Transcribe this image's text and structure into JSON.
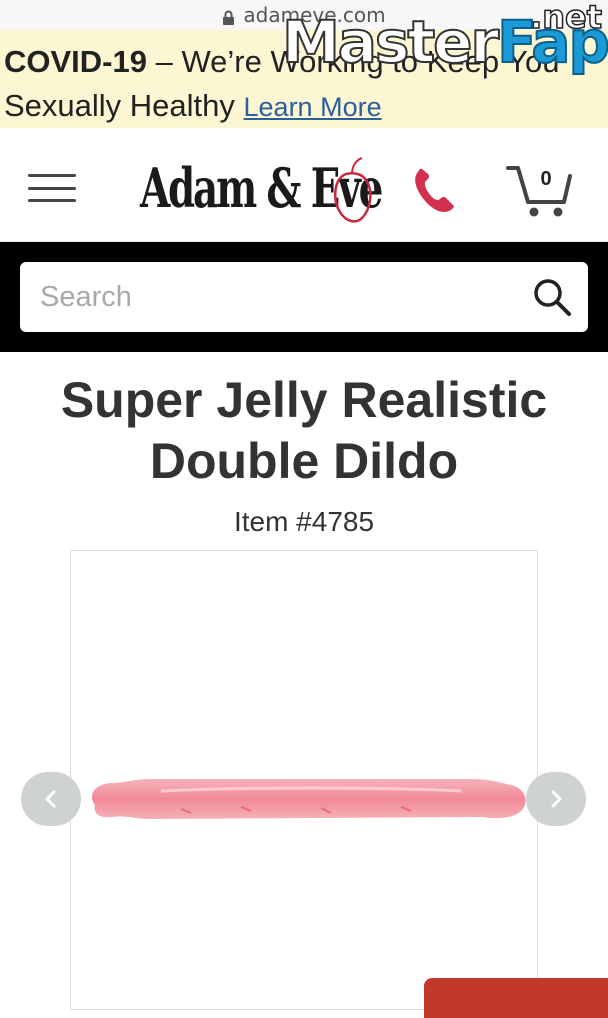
{
  "browser": {
    "url": "adameve.com"
  },
  "watermark": {
    "tld": ".net",
    "name_part1": "Master",
    "name_part2": "Fap"
  },
  "banner": {
    "bold": "COVID-19",
    "text_line1": " – We’re Working to Keep You",
    "text_line2": "Sexually Healthy ",
    "link": "Learn More"
  },
  "header": {
    "logo_text": "Adam & Eve",
    "cart_count": "0"
  },
  "search": {
    "placeholder": "Search"
  },
  "product": {
    "title": "Super Jelly Realistic Double Dildo",
    "item_number": "Item #4785"
  },
  "colors": {
    "banner_bg": "#fdf6d2",
    "link": "#2b5f9e",
    "phone": "#d1314f",
    "search_band": "#000000",
    "button": "#c0392b"
  }
}
